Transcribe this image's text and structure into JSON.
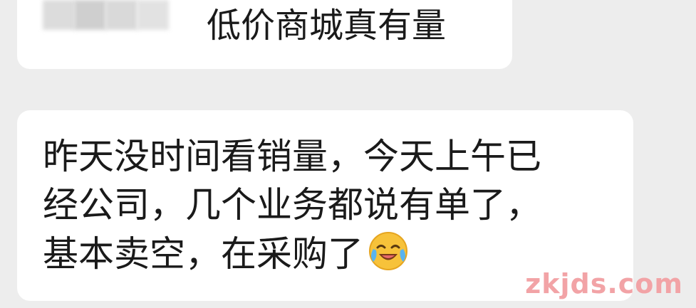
{
  "chat": {
    "top_message": {
      "text": "低价商城真有量"
    },
    "main_message": {
      "line1": "昨天没时间看销量，今天上午已",
      "line2": "经公司，几个业务都说有单了，",
      "line3": "基本卖空，在采购了",
      "emoji_icon": "loudly-crying-laughing-face-icon"
    }
  },
  "watermark": {
    "text": "zkjds.com",
    "color": "#f2a3a6"
  },
  "colors": {
    "background": "#ededed",
    "bubble": "#ffffff",
    "text": "#1a1a1a"
  }
}
